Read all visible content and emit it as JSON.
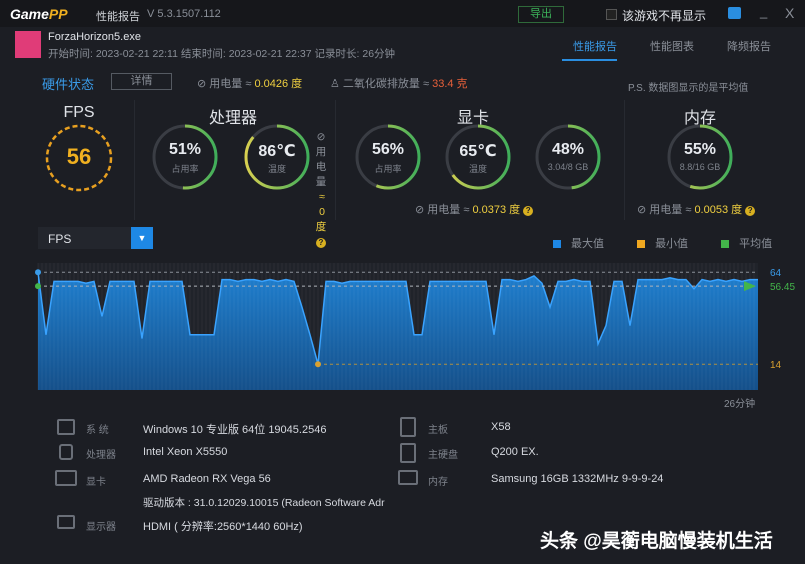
{
  "titlebar": {
    "logo_a": "Game",
    "logo_b": "PP",
    "title": "性能报告",
    "version": "V 5.3.1507.112",
    "export": "导出",
    "dont_show": "该游戏不再显示",
    "minimize": "_",
    "close": "X"
  },
  "game": {
    "exe": "ForzaHorizon5.exe",
    "meta": "开始时间: 2023-02-21 22:11   结束时间: 2023-02-21 22:37   记录时长: 26分钟"
  },
  "tabs": [
    {
      "label": "性能报告"
    },
    {
      "label": "性能图表"
    },
    {
      "label": "降频报告"
    }
  ],
  "status": {
    "title": "硬件状态",
    "details": "详情",
    "power_label": "用电量 ≈",
    "power_value": "0.0426 度",
    "co2_label": "二氧化碳排放量 ≈",
    "co2_value": "33.4 克",
    "note": "P.S. 数据图显示的是平均值"
  },
  "sections": {
    "fps": "FPS",
    "cpu": "处理器",
    "gpu": "显卡",
    "mem": "内存"
  },
  "fps_value": "56",
  "gauges": {
    "cpu_usage": {
      "value": "51%",
      "sub": "占用率",
      "fraction": 0.51
    },
    "cpu_temp": {
      "value": "86℃",
      "sub": "温度",
      "fraction": 0.86
    },
    "gpu_usage": {
      "value": "56%",
      "sub": "占用率",
      "fraction": 0.56
    },
    "gpu_temp": {
      "value": "65℃",
      "sub": "温度",
      "fraction": 0.65
    },
    "gpu_vram": {
      "value": "48%",
      "sub": "3.04/8 GB",
      "fraction": 0.48
    },
    "mem": {
      "value": "55%",
      "sub": "8.8/16 GB",
      "fraction": 0.55
    }
  },
  "cpu_power": {
    "l1": "用电",
    "l2": "量",
    "l3": "≈ 0",
    "l4": "度"
  },
  "gpu_power": {
    "label": "用电量 ≈",
    "value": "0.0373 度"
  },
  "mem_power": {
    "label": "用电量 ≈",
    "value": "0.0053 度"
  },
  "select": {
    "value": "FPS"
  },
  "legend": [
    {
      "label": "最大值",
      "color": "#1e88e5"
    },
    {
      "label": "最小值",
      "color": "#f0a820"
    },
    {
      "label": "平均值",
      "color": "#43b54a"
    }
  ],
  "chart_data": {
    "type": "area",
    "title": "FPS",
    "xlabel": "26分钟",
    "x_range": [
      0,
      26
    ],
    "ylim": [
      0,
      69
    ],
    "max": 64,
    "min": 14,
    "avg": 56.45,
    "max_label": "64",
    "min_label": "14",
    "avg_label": "56.45",
    "values": [
      64,
      30,
      59,
      59,
      59,
      59,
      58,
      59,
      40,
      59,
      59,
      59,
      59,
      28,
      59,
      59,
      59,
      59,
      59,
      30,
      30,
      30,
      30,
      60,
      60,
      59,
      60,
      60,
      59,
      60,
      59,
      60,
      59,
      45,
      30,
      14,
      59,
      59,
      58,
      59,
      59,
      59,
      59,
      59,
      59,
      59,
      59,
      30,
      30,
      59,
      59,
      59,
      59,
      59,
      59,
      59,
      59,
      30,
      60,
      60,
      59,
      60,
      62,
      58,
      45,
      59,
      59,
      60,
      59,
      59,
      25,
      35,
      59,
      59,
      35,
      60,
      60,
      60,
      60,
      61,
      60,
      60,
      55,
      60,
      59,
      60,
      59,
      60,
      59,
      60,
      60
    ]
  },
  "info": [
    {
      "label": "系  统",
      "value": "Windows 10 专业版 64位 19045.2546"
    },
    {
      "label": "处理器",
      "value": "Intel Xeon X5550"
    },
    {
      "label": "显卡",
      "value": "AMD Radeon RX Vega 56"
    },
    {
      "label": "",
      "value": "驱动版本 : 31.0.12029.10015 (Radeon Software Adr"
    },
    {
      "label": "显示器",
      "value": "HDMI ( 分辨率:2560*1440 60Hz)"
    },
    {
      "label": "主板",
      "value": "X58"
    },
    {
      "label": "主硬盘",
      "value": "Q200 EX."
    },
    {
      "label": "内存",
      "value": "Samsung 16GB 1332MHz 9-9-9-24"
    }
  ],
  "watermark": "头条 @昊蘅电脑慢装机生活"
}
